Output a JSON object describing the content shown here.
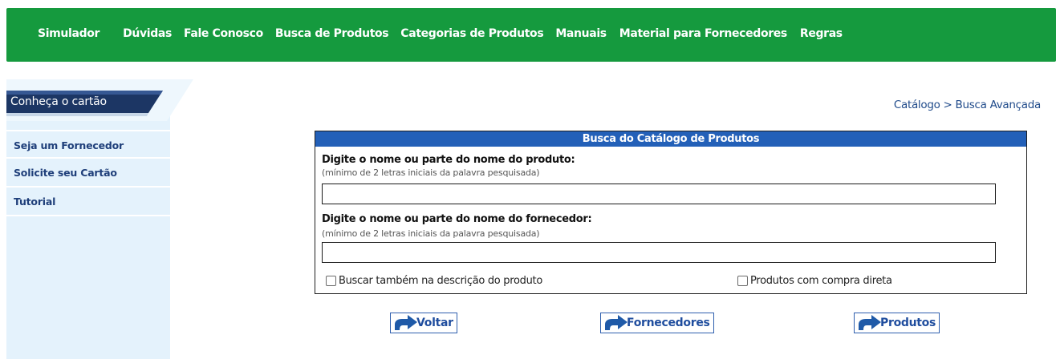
{
  "nav": {
    "items": [
      {
        "label": "Simulador"
      },
      {
        "label": "Dúvidas"
      },
      {
        "label": "Fale Conosco"
      },
      {
        "label": "Busca de Produtos"
      },
      {
        "label": "Categorias de Produtos"
      },
      {
        "label": "Manuais"
      },
      {
        "label": "Material para Fornecedores"
      },
      {
        "label": "Regras"
      }
    ]
  },
  "sidebar": {
    "header": "Conheça o cartão",
    "items": [
      {
        "label": "Seja um Fornecedor"
      },
      {
        "label": "Solicite seu Cartão"
      },
      {
        "label": "Tutorial"
      }
    ]
  },
  "breadcrumb": "Catálogo > Busca Avançada",
  "search": {
    "title": "Busca do Catálogo de Produtos",
    "product_label": "Digite o nome ou parte do nome do produto:",
    "product_hint": "(mínimo de 2 letras iniciais da palavra pesquisada)",
    "product_value": "",
    "supplier_label": "Digite o nome ou parte do nome do fornecedor:",
    "supplier_hint": "(mínimo de 2 letras iniciais da palavra pesquisada)",
    "supplier_value": "",
    "checkbox_description": "Buscar também na descrição do produto",
    "checkbox_direct": "Produtos com compra direta"
  },
  "buttons": {
    "back": "Voltar",
    "suppliers": "Fornecedores",
    "products": "Produtos"
  },
  "colors": {
    "nav_bg": "#159a3e",
    "sidebar_bg": "#e4f2fc",
    "header_blue": "#2360b8",
    "link_blue": "#1f3f7a"
  }
}
